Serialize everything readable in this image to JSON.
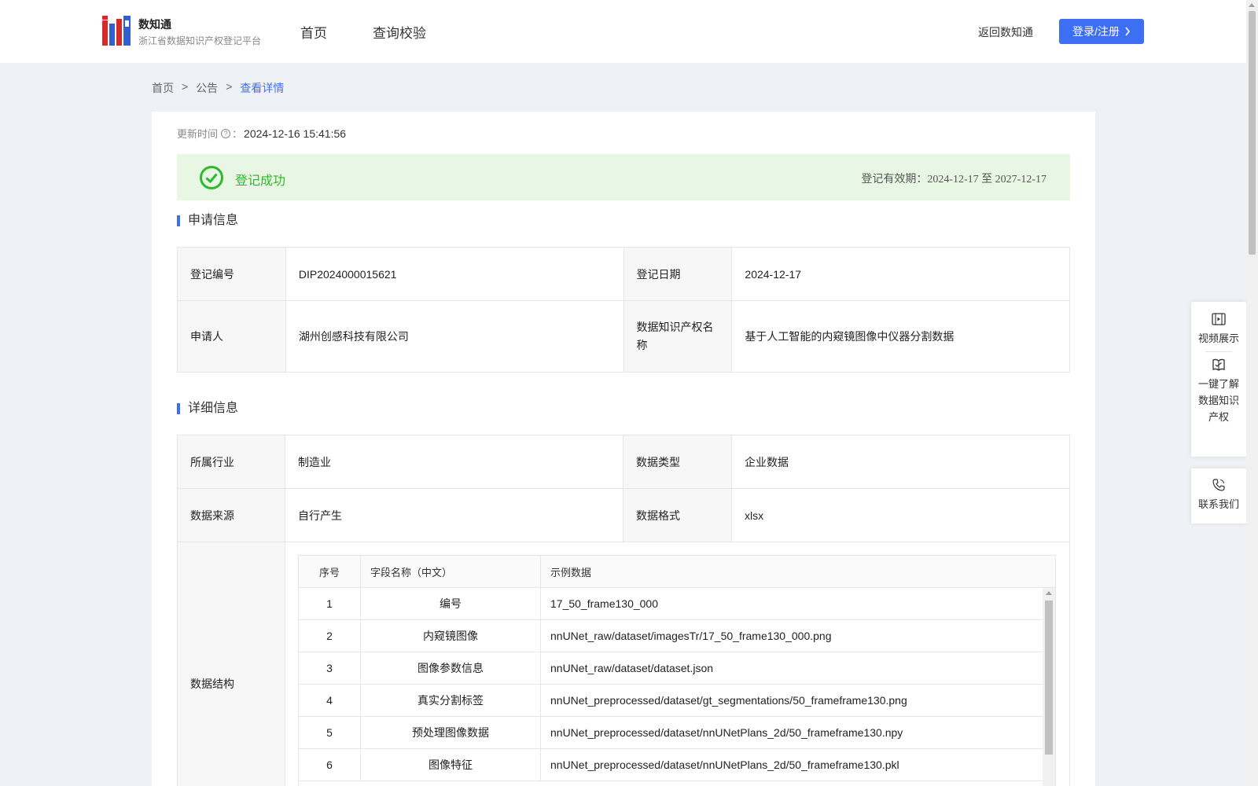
{
  "header": {
    "logo_title": "数知通",
    "logo_subtitle": "浙江省数据知识产权登记平台",
    "nav": [
      "首页",
      "查询校验"
    ],
    "back_link": "返回数知通",
    "login_label": "登录/注册"
  },
  "breadcrumb": [
    "首页",
    "公告",
    "查看详情"
  ],
  "breadcrumb_sep": ">",
  "update": {
    "label": "更新时间",
    "help_icon": "question-circle-icon",
    "colon": "：",
    "value": "2024-12-16 15:41:56"
  },
  "status": {
    "icon": "check-circle-icon",
    "text": "登记成功",
    "validity_label": "登记有效期：",
    "validity_value": "2024-12-17 至 2027-12-17",
    "color": "#2eb82e",
    "bg_color": "#e8f7e4"
  },
  "application": {
    "title": "申请信息",
    "reg_no_label": "登记编号",
    "reg_no": "DIP2024000015621",
    "reg_date_label": "登记日期",
    "reg_date": "2024-12-17",
    "applicant_label": "申请人",
    "applicant": "湖州创感科技有限公司",
    "ip_name_label": "数据知识产权名称",
    "ip_name": "基于人工智能的内窥镜图像中仪器分割数据"
  },
  "details": {
    "title": "详细信息",
    "industry_label": "所属行业",
    "industry": "制造业",
    "data_type_label": "数据类型",
    "data_type": "企业数据",
    "source_label": "数据来源",
    "source": "自行产生",
    "format_label": "数据格式",
    "format": "xlsx",
    "structure_label": "数据结构"
  },
  "structure_table": {
    "headers": [
      "序号",
      "字段名称（中文）",
      "示例数据"
    ],
    "rows": [
      {
        "no": "1",
        "name": "编号",
        "example": "17_50_frame130_000"
      },
      {
        "no": "2",
        "name": "内窥镜图像",
        "example": "nnUNet_raw/dataset/imagesTr/17_50_frame130_000.png"
      },
      {
        "no": "3",
        "name": "图像参数信息",
        "example": "nnUNet_raw/dataset/dataset.json"
      },
      {
        "no": "4",
        "name": "真实分割标签",
        "example": "nnUNet_preprocessed/dataset/gt_segmentations/50_frameframe130.png"
      },
      {
        "no": "5",
        "name": "预处理图像数据",
        "example": "nnUNet_preprocessed/dataset/nnUNetPlans_2d/50_frameframe130.npy"
      },
      {
        "no": "6",
        "name": "图像特征",
        "example": "nnUNet_preprocessed/dataset/nnUNetPlans_2d/50_frameframe130.pkl"
      }
    ]
  },
  "side_panel": {
    "video": "视频展示",
    "learn": "一键了解数据知识产权",
    "contact": "联系我们"
  },
  "colors": {
    "accent": "#3d6ff5",
    "page_bg": "#eef1f5"
  }
}
